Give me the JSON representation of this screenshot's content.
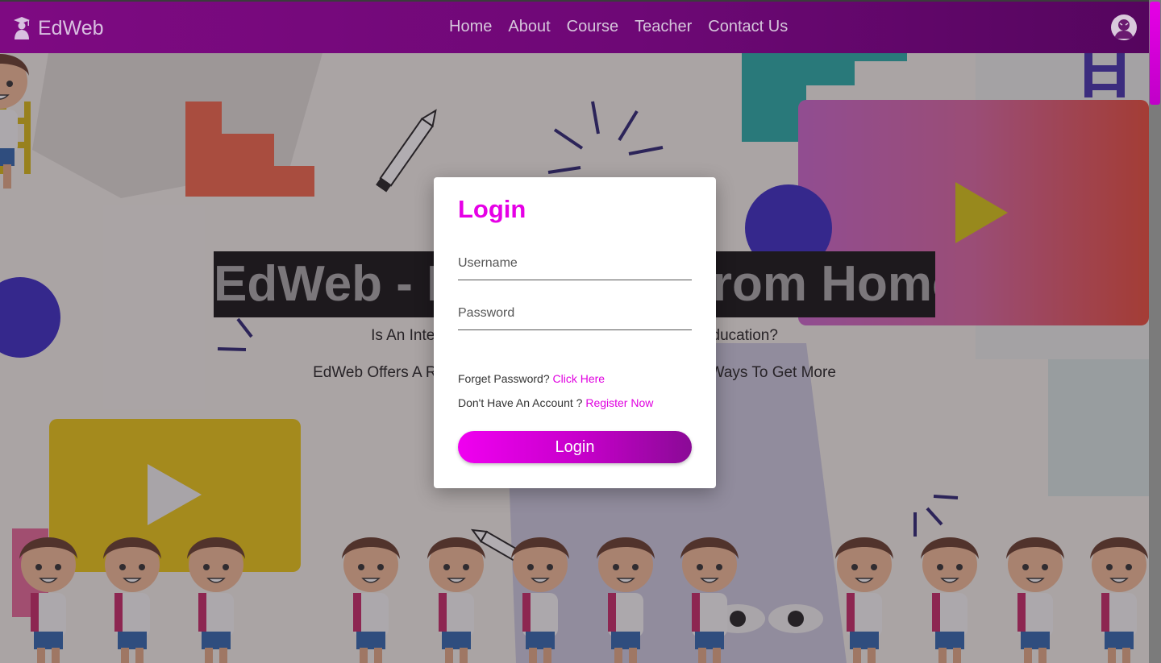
{
  "brand": {
    "name": "EdWeb",
    "icon": "graduate-icon"
  },
  "nav": {
    "links": [
      "Home",
      "About",
      "Course",
      "Teacher",
      "Contact Us"
    ],
    "avatar_icon": "user-avatar-icon"
  },
  "hero": {
    "title": "EdWeb - Education From Home",
    "subtitle_1": "Is An Internet Based Platform For Online School Education?",
    "subtitle_2": "EdWeb Offers A Range Of Online Courses And Innovative Ways To Get More"
  },
  "login_modal": {
    "title": "Login",
    "username_placeholder": "Username",
    "password_placeholder": "Password",
    "forgot_text": "Forget Password?",
    "forgot_link": "Click Here",
    "register_text": "Don't Have An Account ?",
    "register_link": "Register Now",
    "submit_label": "Login"
  },
  "colors": {
    "nav_bg": "#7e0a82",
    "accent": "#e600e6",
    "button_start": "#f000f0",
    "button_end": "#8a0a96"
  }
}
